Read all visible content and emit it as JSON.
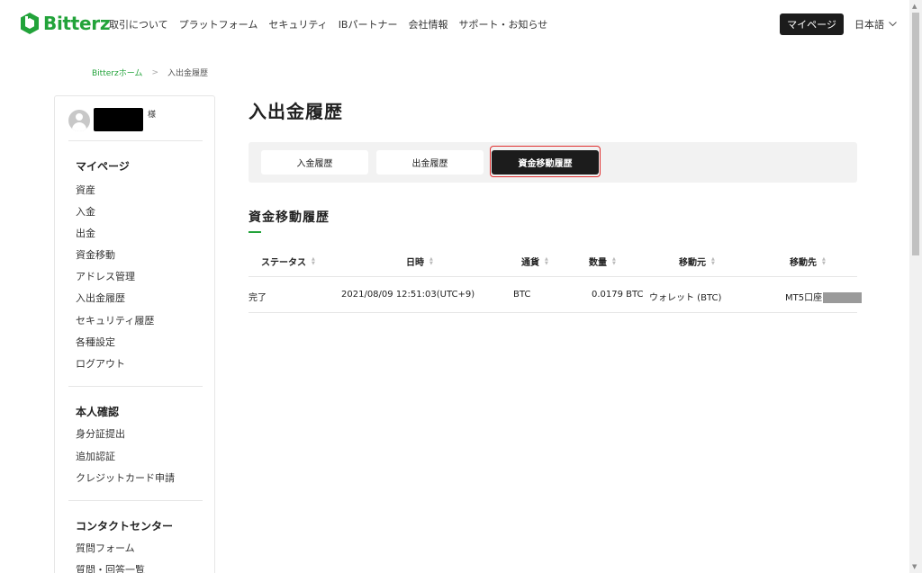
{
  "header": {
    "brand": "Bitterz",
    "brand_color": "#22a33a",
    "nav": [
      "取引について",
      "プラットフォーム",
      "セキュリティ",
      "IBパートナー",
      "会社情報",
      "サポート・お知らせ"
    ],
    "mypage_button": "マイページ",
    "language": "日本語"
  },
  "breadcrumb": {
    "home": "Bitterzホーム",
    "separator": ">",
    "current": "入出金履歴"
  },
  "sidebar": {
    "honorific": "様",
    "sections": [
      {
        "title": "マイページ",
        "items": [
          "資産",
          "入金",
          "出金",
          "資金移動",
          "アドレス管理",
          "入出金履歴",
          "セキュリティ履歴",
          "各種設定",
          "ログアウト"
        ]
      },
      {
        "title": "本人確認",
        "items": [
          "身分証提出",
          "追加認証",
          "クレジットカード申請"
        ]
      },
      {
        "title": "コンタクトセンター",
        "items": [
          "質問フォーム",
          "質問・回答一覧"
        ]
      }
    ]
  },
  "main": {
    "page_title": "入出金履歴",
    "tabs": [
      {
        "label": "入金履歴",
        "active": false
      },
      {
        "label": "出金履歴",
        "active": false
      },
      {
        "label": "資金移動履歴",
        "active": true
      }
    ],
    "section_title": "資金移動履歴",
    "table": {
      "headers": [
        "ステータス",
        "日時",
        "通貨",
        "数量",
        "移動元",
        "移動先"
      ],
      "rows": [
        [
          "完了",
          "2021/08/09 12:51:03(UTC+9)",
          "BTC",
          "0.0179 BTC",
          "ウォレット (BTC)",
          "MT5口座"
        ]
      ]
    }
  }
}
